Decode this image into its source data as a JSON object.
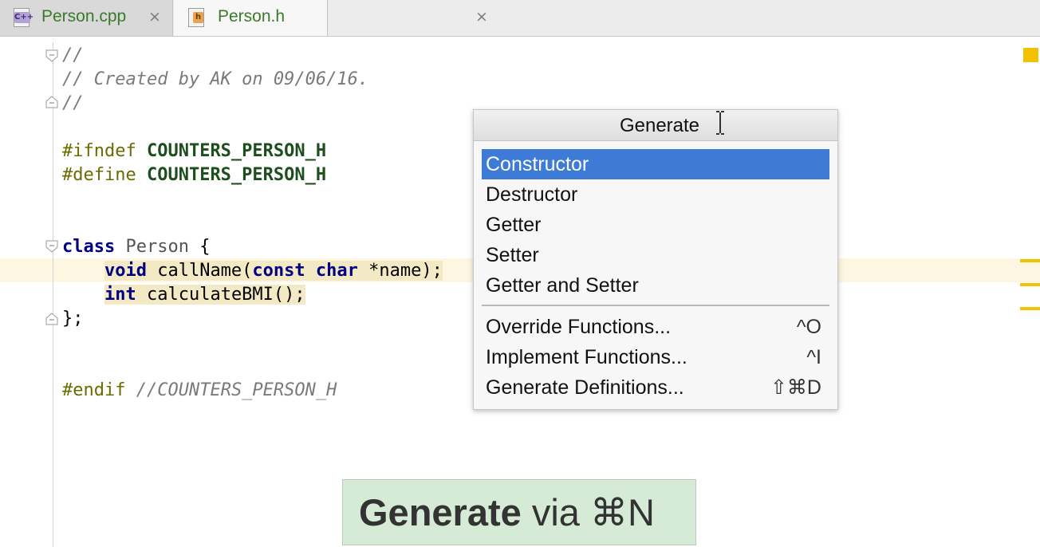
{
  "tabs": [
    {
      "label": "Person.cpp",
      "icon": "cpp-file-icon",
      "close": "×"
    },
    {
      "label": "Person.h",
      "icon": "header-file-icon",
      "close": "×"
    }
  ],
  "file_icons": {
    "cpp_badge": "C++",
    "h_badge": "h"
  },
  "code": {
    "l1": "//",
    "l2": "// Created by AK on 09/06/16.",
    "l3": "//",
    "ifndef_kw": "#ifndef",
    "ifndef_name": "COUNTERS_PERSON_H",
    "define_kw": "#define",
    "define_name": "COUNTERS_PERSON_H",
    "class_kw": "class",
    "class_name": "Person",
    "class_brace": " {",
    "m1_void": "void",
    "m1_rest1": " callName(",
    "m1_const": "const",
    "m1_char": "char",
    "m1_rest2": " *name);",
    "m2_int": "int",
    "m2_rest": " calculateBMI();",
    "close": "};",
    "endif_kw": "#endif",
    "endif_comment": "//COUNTERS_PERSON_H"
  },
  "popup": {
    "title": "Generate",
    "items": [
      {
        "label": "Constructor",
        "shortcut": ""
      },
      {
        "label": "Destructor",
        "shortcut": ""
      },
      {
        "label": "Getter",
        "shortcut": ""
      },
      {
        "label": "Setter",
        "shortcut": ""
      },
      {
        "label": "Getter and Setter",
        "shortcut": ""
      },
      {
        "label": "Override Functions...",
        "shortcut": "^O"
      },
      {
        "label": "Implement Functions...",
        "shortcut": "^I"
      },
      {
        "label": "Generate Definitions...",
        "shortcut": "⇧⌘D"
      }
    ],
    "selected_index": 0
  },
  "hint": {
    "bold": "Generate",
    "rest": " via ⌘N"
  },
  "colors": {
    "accent": "#3d7bd6",
    "marker": "#f2c200",
    "hint_bg": "#d6ebd6"
  }
}
